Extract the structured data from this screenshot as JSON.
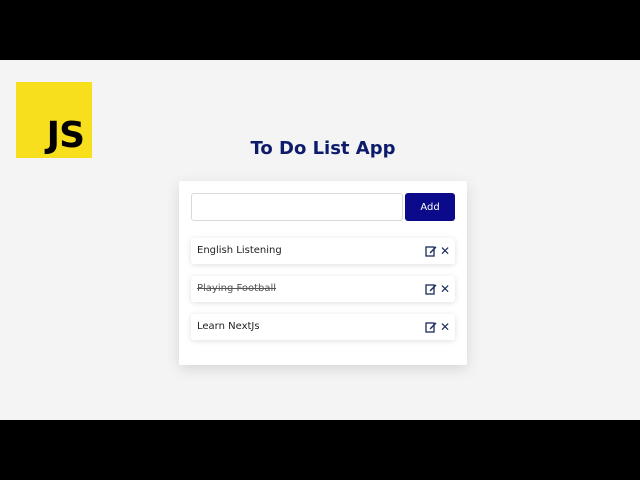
{
  "logo": {
    "text": "JS",
    "color": "#f7df1e"
  },
  "app": {
    "title": "To Do List App"
  },
  "form": {
    "input_value": "",
    "add_label": "Add",
    "button_color": "#0a0a8a"
  },
  "todos": [
    {
      "label": "English Listening",
      "done": false
    },
    {
      "label": "Playing Football",
      "done": true
    },
    {
      "label": "Learn NextJs",
      "done": false
    }
  ],
  "icons": {
    "edit": "edit-icon",
    "delete": "close-icon",
    "delete_glyph": "✕"
  }
}
